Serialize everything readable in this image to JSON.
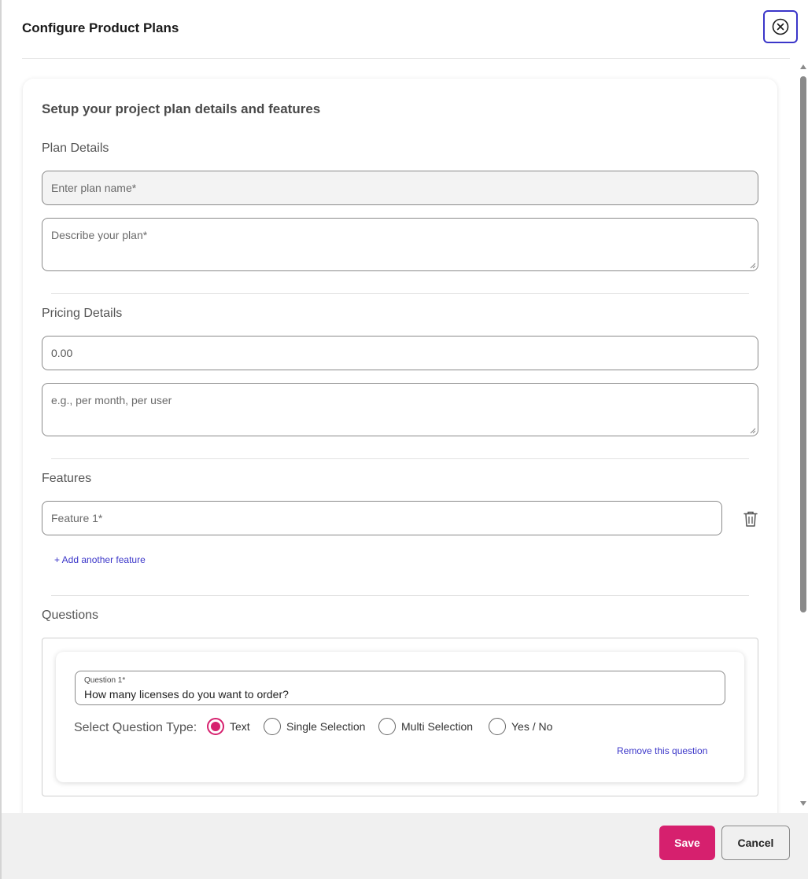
{
  "modal": {
    "title": "Configure Product Plans"
  },
  "card": {
    "title": "Setup your project plan details and features"
  },
  "plan_details": {
    "label": "Plan Details",
    "name_placeholder": "Enter plan name*",
    "description_placeholder": "Describe your plan*"
  },
  "pricing_details": {
    "label": "Pricing Details",
    "price_value": "0.00",
    "unit_placeholder": "e.g., per month, per user"
  },
  "features": {
    "label": "Features",
    "feature_1_placeholder": "Feature 1*",
    "add_link": "+ Add another feature"
  },
  "questions": {
    "label": "Questions",
    "question_1_label": "Question 1*",
    "question_1_value": "How many licenses do you want to order?",
    "type_label": "Select Question Type:",
    "types": [
      "Text",
      "Single Selection",
      "Multi Selection",
      "Yes / No"
    ],
    "selected_type": "Text",
    "remove_link": "Remove this question"
  },
  "footer": {
    "save_label": "Save",
    "cancel_label": "Cancel"
  },
  "colors": {
    "accent": "#d6206e",
    "link": "#3b36c9",
    "focus_border": "#3b36c9"
  }
}
